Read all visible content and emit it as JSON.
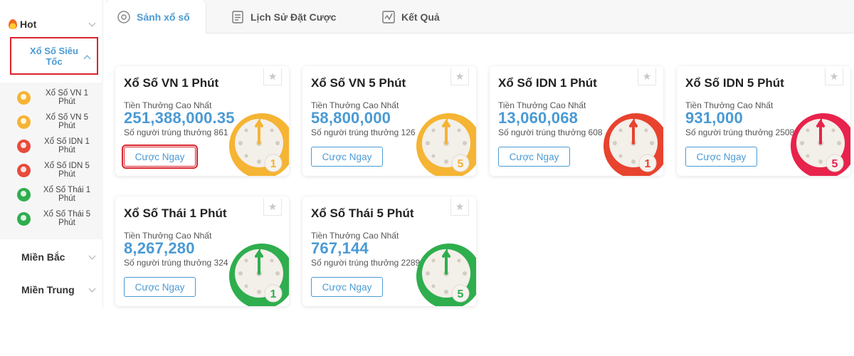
{
  "sidebar": {
    "hot_label": "Hot",
    "active_group_label": "Xổ Số Siêu Tốc",
    "items": [
      {
        "label": "Xổ Số VN 1 Phút",
        "color": "#f5b433"
      },
      {
        "label": "Xổ Số VN 5 Phút",
        "color": "#f5b433"
      },
      {
        "label": "Xổ Số IDN 1 Phút",
        "color": "#e84b3c"
      },
      {
        "label": "Xổ Số IDN 5 Phút",
        "color": "#e84b3c"
      },
      {
        "label": "Xổ Số Thái 1 Phút",
        "color": "#2fae4e"
      },
      {
        "label": "Xổ Số Thái 5 Phút",
        "color": "#2fae4e"
      }
    ],
    "sections": [
      {
        "label": "Miền Bắc"
      },
      {
        "label": "Miền Trung"
      }
    ]
  },
  "tabs": [
    {
      "label": "Sảnh xổ số",
      "icon": "lottery-lobby-icon"
    },
    {
      "label": "Lịch Sử Đặt Cược",
      "icon": "bet-history-icon"
    },
    {
      "label": "Kết Quả",
      "icon": "results-chart-icon"
    }
  ],
  "cards": [
    {
      "title": "Xổ Số VN 1 Phút",
      "prize_label": "Tiền Thưởng Cao Nhất",
      "prize": "251,388,000.35",
      "winners": "Số người trúng thưởng 861",
      "button": "Cược Ngay",
      "color": "#f5b433",
      "digit": "1"
    },
    {
      "title": "Xổ Số VN 5 Phút",
      "prize_label": "Tiền Thưởng Cao Nhất",
      "prize": "58,800,000",
      "winners": "Số người trúng thưởng 126",
      "button": "Cược Ngay",
      "color": "#f5b433",
      "digit": "5"
    },
    {
      "title": "Xổ Số IDN 1 Phút",
      "prize_label": "Tiền Thưởng Cao Nhất",
      "prize": "13,060,068",
      "winners": "Số người trúng thưởng 608",
      "button": "Cược Ngay",
      "color": "#e8432e",
      "digit": "1"
    },
    {
      "title": "Xổ Số IDN 5 Phút",
      "prize_label": "Tiền Thưởng Cao Nhất",
      "prize": "931,000",
      "winners": "Số người trúng thưởng 2508",
      "button": "Cược Ngay",
      "color": "#e8234c",
      "digit": "5"
    },
    {
      "title": "Xổ Số Thái 1 Phút",
      "prize_label": "Tiền Thưởng Cao Nhất",
      "prize": "8,267,280",
      "winners": "Số người trúng thưởng 324",
      "button": "Cược Ngay",
      "color": "#2fae4e",
      "digit": "1"
    },
    {
      "title": "Xổ Số Thái 5 Phút",
      "prize_label": "Tiền Thưởng Cao Nhất",
      "prize": "767,144",
      "winners": "Số người trúng thưởng 2289",
      "button": "Cược Ngay",
      "color": "#2fae4e",
      "digit": "5"
    }
  ],
  "colors": {
    "accent": "#4a9ad4",
    "highlight": "#d9232d"
  }
}
